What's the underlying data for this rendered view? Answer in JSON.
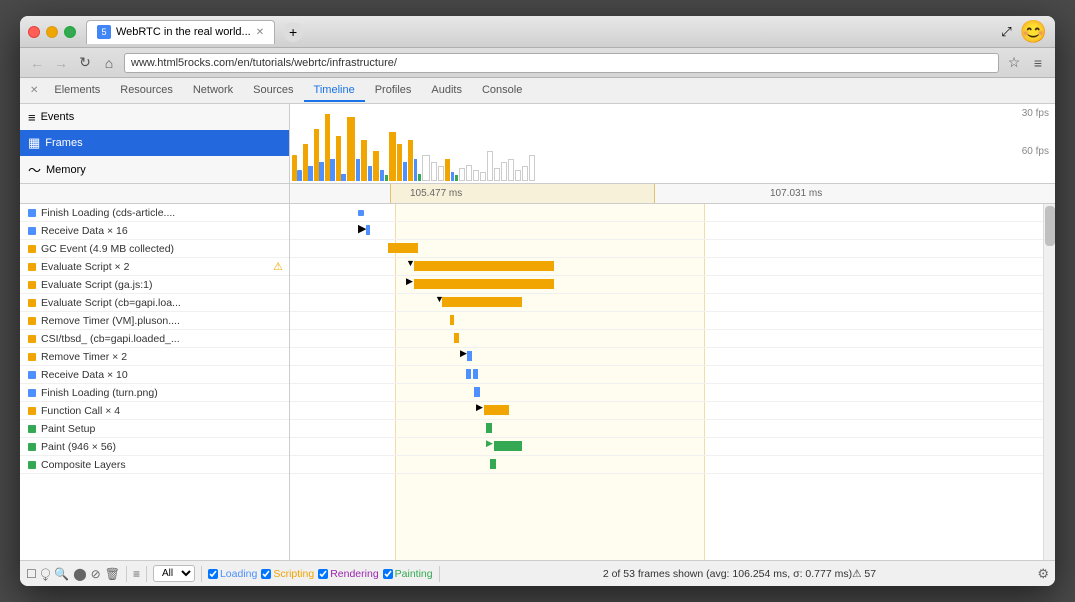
{
  "browser": {
    "traffic_lights": [
      "red",
      "yellow",
      "green"
    ],
    "tab": {
      "label": "WebRTC in the real world...",
      "favicon": "W"
    },
    "url": "www.html5rocks.com/en/tutorials/webrtc/infrastructure/",
    "expand_label": "⤢",
    "emoji": "😊"
  },
  "nav": {
    "back": "←",
    "forward": "→",
    "reload": "↻",
    "home": "⌂",
    "star": "☆",
    "menu": "≡"
  },
  "devtools": {
    "close": "✕",
    "tabs": [
      "Elements",
      "Resources",
      "Network",
      "Sources",
      "Timeline",
      "Profiles",
      "Audits",
      "Console"
    ],
    "active_tab": "Timeline"
  },
  "timeline": {
    "sidebar_items": [
      {
        "id": "events",
        "icon": "≡",
        "label": "Events"
      },
      {
        "id": "frames",
        "icon": "📊",
        "label": "Frames",
        "active": true
      },
      {
        "id": "memory",
        "icon": "~",
        "label": "Memory"
      }
    ],
    "fps_labels": [
      "30 fps",
      "60 fps"
    ],
    "ruler": {
      "marks": [
        "105.477 ms",
        "107.031 ms"
      ]
    },
    "events": [
      {
        "color": "blue",
        "name": "Finish Loading (cds-article...."
      },
      {
        "color": "blue",
        "name": "Receive Data × 16"
      },
      {
        "color": "yellow",
        "name": "GC Event (4.9 MB collected)"
      },
      {
        "color": "yellow",
        "name": "Evaluate Script × 2",
        "warn": true
      },
      {
        "color": "yellow",
        "name": "Evaluate Script (ga.js:1)"
      },
      {
        "color": "yellow",
        "name": "Evaluate Script (cb=gapi.loa..."
      },
      {
        "color": "yellow",
        "name": "Remove Timer (VM].pluson...."
      },
      {
        "color": "yellow",
        "name": "CSI/tbsd_ (cb=gapi.loaded_..."
      },
      {
        "color": "yellow",
        "name": "Remove Timer × 2"
      },
      {
        "color": "blue",
        "name": "Receive Data × 10"
      },
      {
        "color": "blue",
        "name": "Finish Loading (turn.png)"
      },
      {
        "color": "yellow",
        "name": "Function Call × 4"
      },
      {
        "color": "green",
        "name": "Paint Setup"
      },
      {
        "color": "green",
        "name": "Paint (946 × 56)"
      },
      {
        "color": "green",
        "name": "Composite Layers"
      }
    ]
  },
  "status_bar": {
    "icons": [
      "☐",
      "⧬",
      "🔍",
      "⬤",
      "⊘",
      "🗑",
      "≡"
    ],
    "filter_label": "All",
    "checkboxes": [
      {
        "id": "loading",
        "label": "Loading",
        "checked": true
      },
      {
        "id": "scripting",
        "label": "Scripting",
        "checked": true
      },
      {
        "id": "rendering",
        "label": "Rendering",
        "checked": true
      },
      {
        "id": "painting",
        "label": "Painting",
        "checked": true
      }
    ],
    "info": "2 of 53 frames shown (avg: 106.254 ms, σ: 0.777 ms)⚠ 57",
    "gear": "⚙"
  }
}
